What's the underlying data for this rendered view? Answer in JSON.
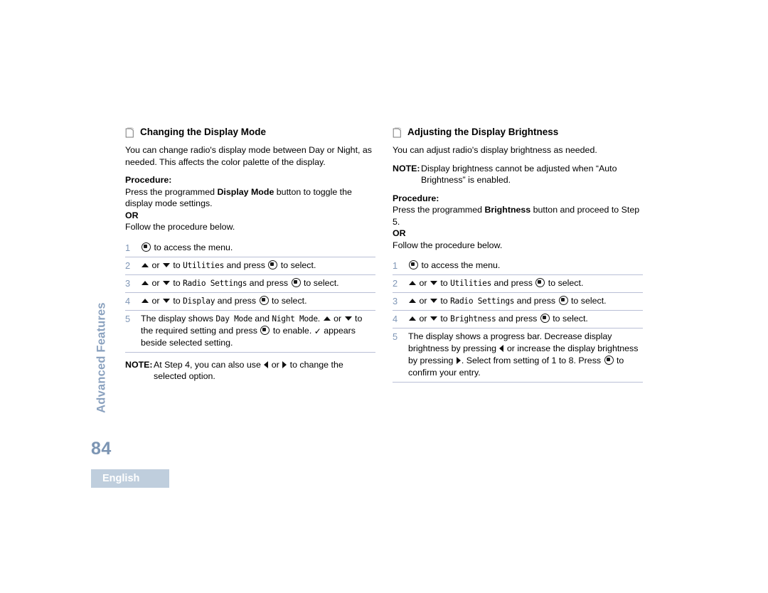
{
  "sidebar": {
    "tab_label": "Advanced Features",
    "page_number": "84",
    "language_badge": "English",
    "accent_color": "#8ba2bf",
    "badge_bg": "#bfcedd"
  },
  "icons": {
    "heading": "page-document-icon",
    "menu_button": "menu-select-button-icon",
    "up": "up-triangle-icon",
    "down": "down-triangle-icon",
    "left": "left-triangle-icon",
    "right": "right-triangle-icon",
    "check": "checkmark-icon",
    "check_glyph": "✓"
  },
  "left_column": {
    "heading": "Changing the Display Mode",
    "intro": "You can change radio's display mode between Day or Night, as needed. This affects the color palette of the display.",
    "procedure_label": "Procedure:",
    "procedure_text_a": "Press the programmed ",
    "procedure_bold": "Display Mode",
    "procedure_text_b": " button to toggle the display mode settings.",
    "or_label": "OR",
    "follow_text": "Follow the procedure below.",
    "steps": [
      {
        "num": "1",
        "parts": [
          "icon:menu",
          " to access the menu."
        ]
      },
      {
        "num": "2",
        "parts": [
          "icon:up",
          " or ",
          "icon:down",
          " to ",
          "mono:Utilities",
          " and press ",
          "icon:menu",
          " to select."
        ]
      },
      {
        "num": "3",
        "parts": [
          "icon:up",
          " or ",
          "icon:down",
          " to ",
          "mono:Radio Settings",
          " and press ",
          "icon:menu",
          " to select."
        ]
      },
      {
        "num": "4",
        "parts": [
          "icon:up",
          " or ",
          "icon:down",
          " to ",
          "mono:Display",
          " and press ",
          "icon:menu",
          " to select."
        ]
      },
      {
        "num": "5",
        "parts": [
          "The display shows ",
          "mono:Day Mode",
          " and ",
          "mono:Night Mode",
          ". ",
          "icon:up",
          " or ",
          "icon:down",
          " to the required setting and press ",
          "icon:menu",
          " to enable. ",
          "icon:check",
          " appears beside selected setting."
        ]
      }
    ],
    "note": {
      "label": "NOTE:",
      "parts": [
        "At Step 4, you can also use ",
        "icon:left",
        " or ",
        "icon:right",
        " to change the selected option."
      ]
    }
  },
  "right_column": {
    "heading": "Adjusting the Display Brightness",
    "intro": "You can adjust radio's display brightness as needed.",
    "note": {
      "label": "NOTE:",
      "parts": [
        "Display brightness cannot be adjusted when “Auto Brightness” is enabled."
      ]
    },
    "procedure_label": "Procedure:",
    "procedure_text_a": "Press the programmed ",
    "procedure_bold": "Brightness",
    "procedure_text_b": " button and proceed to Step 5.",
    "or_label": "OR",
    "follow_text": "Follow the procedure below.",
    "steps": [
      {
        "num": "1",
        "parts": [
          "icon:menu",
          " to access the menu."
        ]
      },
      {
        "num": "2",
        "parts": [
          "icon:up",
          " or ",
          "icon:down",
          " to ",
          "mono:Utilities",
          " and press ",
          "icon:menu",
          " to select."
        ]
      },
      {
        "num": "3",
        "parts": [
          "icon:up",
          " or ",
          "icon:down",
          " to ",
          "mono:Radio Settings",
          " and press ",
          "icon:menu",
          " to select."
        ]
      },
      {
        "num": "4",
        "parts": [
          "icon:up",
          " or ",
          "icon:down",
          " to ",
          "mono:Brightness",
          " and press ",
          "icon:menu",
          " to select."
        ]
      },
      {
        "num": "5",
        "parts": [
          "The display shows a progress bar. Decrease display brightness by pressing ",
          "icon:left",
          " or increase the display brightness by pressing ",
          "icon:right",
          ". Select from setting of 1 to 8. Press ",
          "icon:menu",
          " to confirm your entry."
        ]
      }
    ]
  }
}
